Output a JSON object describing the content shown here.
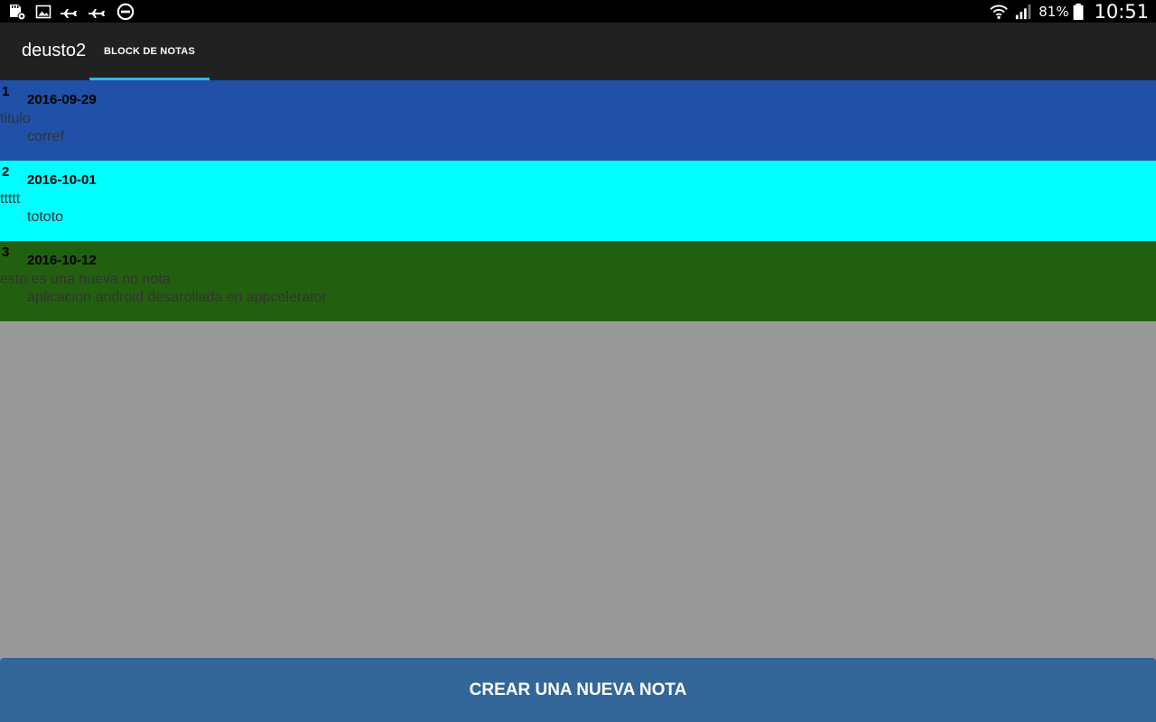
{
  "status_bar": {
    "left_icons": [
      "sd-card-settings-icon",
      "image-icon",
      "airplane-icon",
      "airplane-icon",
      "do-not-disturb-icon"
    ],
    "right_icons": [
      "wifi-icon",
      "signal-icon",
      "battery-icon"
    ],
    "battery_percent": "81%",
    "time": "10:51"
  },
  "action_bar": {
    "app_title": "deusto2",
    "tabs": [
      {
        "label": "BLOCK DE NOTAS",
        "selected": true
      }
    ],
    "indicator_color": "#33b5e5"
  },
  "notes": [
    {
      "id": "1",
      "date": "2016-09-29",
      "title": "titulo",
      "body": "corref",
      "color": "#2050a8"
    },
    {
      "id": "2",
      "date": "2016-10-01",
      "title": "ttttt",
      "body": "tototo",
      "color": "#00ffff"
    },
    {
      "id": "3",
      "date": "2016-10-12",
      "title": "esto es una nueva no nota",
      "body": "aplicacion android desarollada en appcelerator",
      "color": "#226010"
    }
  ],
  "background_color": "#999999",
  "create_button": {
    "label": "CREAR UNA NUEVA NOTA",
    "color": "#336699"
  }
}
